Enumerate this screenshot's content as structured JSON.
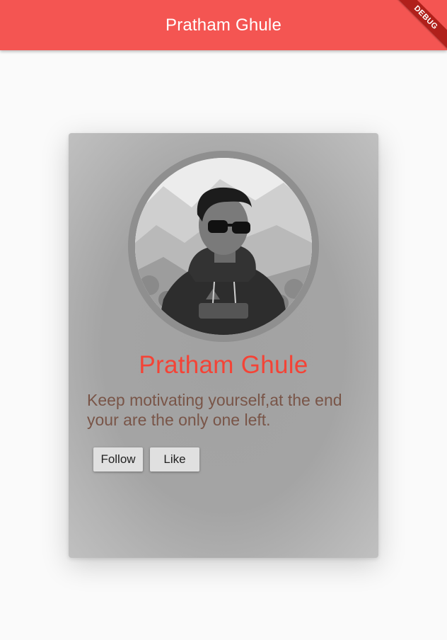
{
  "app_bar": {
    "title": "Pratham Ghule",
    "debug_label": "DEBUG"
  },
  "profile_card": {
    "avatar_icon": "profile-photo",
    "name": "Pratham Ghule",
    "quote": "Keep motivating yourself,at the end your are the only one left.",
    "follow_label": "Follow",
    "like_label": "Like"
  },
  "colors": {
    "app_bar": "#f45552",
    "name": "#f44336",
    "quote": "#795548",
    "button": "#e0e0e0"
  }
}
